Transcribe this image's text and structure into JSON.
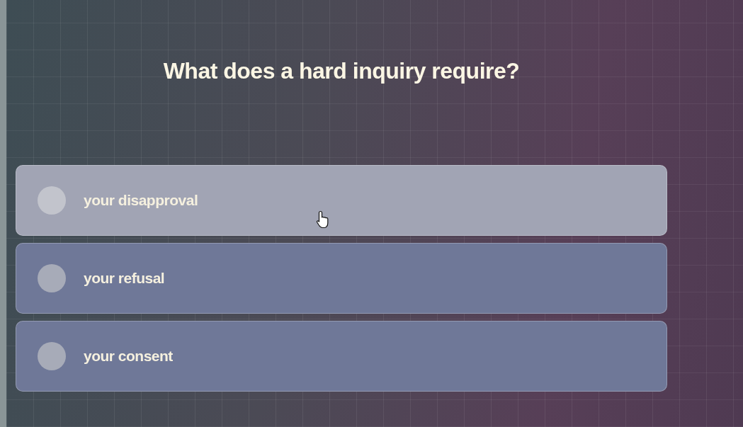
{
  "question": "What does a hard inquiry require?",
  "options": [
    {
      "label": "your disapproval",
      "hovered": true,
      "selected": false
    },
    {
      "label": "your refusal",
      "hovered": false,
      "selected": false
    },
    {
      "label": "your consent",
      "hovered": false,
      "selected": false
    }
  ]
}
